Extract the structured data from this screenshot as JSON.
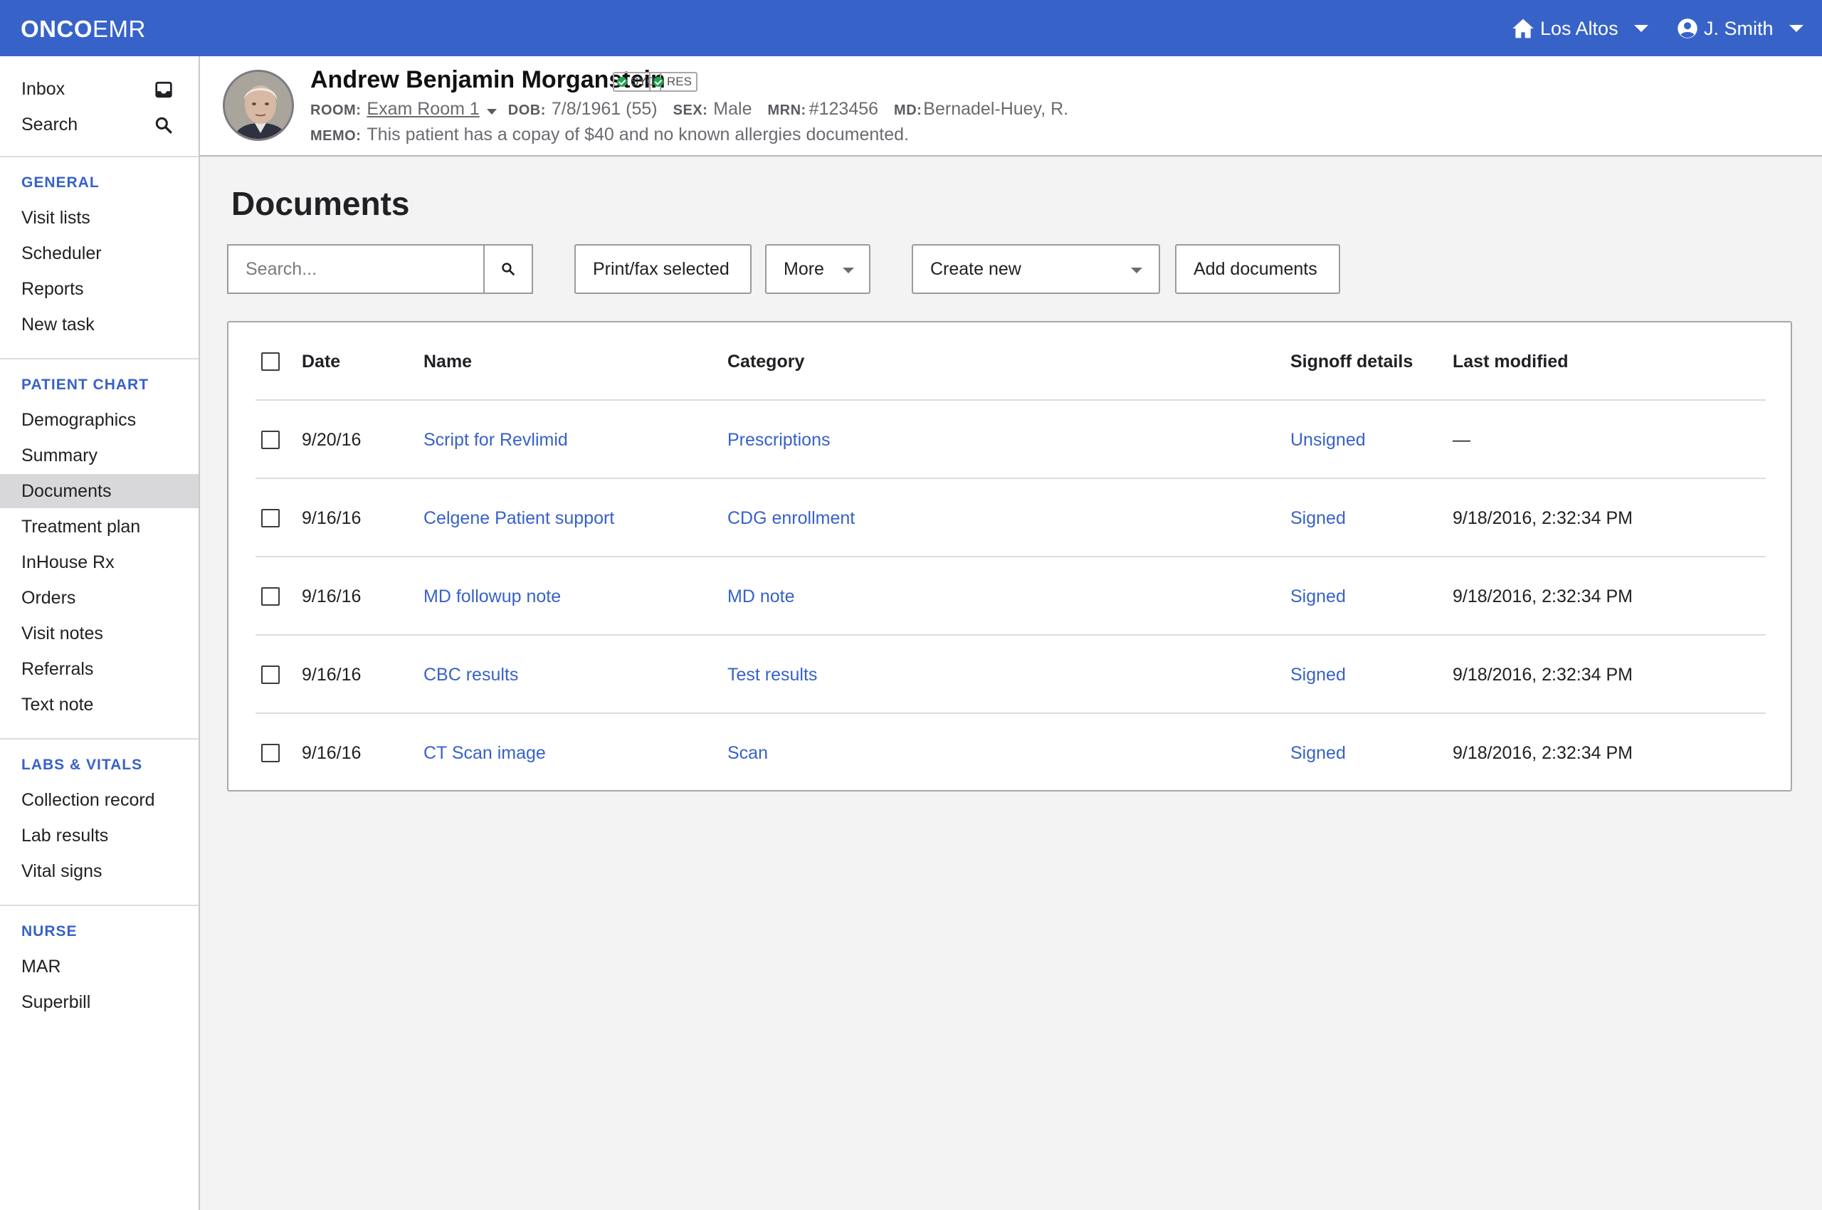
{
  "brand": {
    "bold": "ONCO",
    "light": "EMR"
  },
  "topbar": {
    "location": "Los Altos",
    "user": "J. Smith"
  },
  "sidebar": {
    "top_items": [
      {
        "label": "Inbox",
        "icon": "inbox-icon"
      },
      {
        "label": "Search",
        "icon": "search-icon"
      }
    ],
    "sections": [
      {
        "heading": "GENERAL",
        "items": [
          "Visit lists",
          "Scheduler",
          "Reports",
          "New task"
        ]
      },
      {
        "heading": "PATIENT CHART",
        "items": [
          "Demographics",
          "Summary",
          "Documents",
          "Treatment plan",
          "InHouse Rx",
          "Orders",
          "Visit notes",
          "Referrals",
          "Text note"
        ]
      },
      {
        "heading": "LABS & VITALS",
        "items": [
          "Collection record",
          "Lab results",
          "Vital signs"
        ]
      },
      {
        "heading": "NURSE",
        "items": [
          "MAR",
          "Superbill"
        ]
      }
    ],
    "active": "Documents"
  },
  "patient": {
    "name": "Andrew Benjamin Morganstein",
    "badges": [
      "SYC",
      "RES"
    ],
    "room_label": "ROOM:",
    "room": "Exam Room 1",
    "dob_label": "DOB:",
    "dob": "7/8/1961 (55)",
    "sex_label": "SEX:",
    "sex": "Male",
    "mrn_label": "MRN:",
    "mrn": "#123456",
    "md_label": "MD:",
    "md": "Bernadel-Huey, R.",
    "memo_label": "MEMO:",
    "memo": "This patient has a copay of $40 and no known allergies documented."
  },
  "page": {
    "title": "Documents"
  },
  "toolbar": {
    "search_placeholder": "Search...",
    "print_fax": "Print/fax selected",
    "more": "More",
    "create_new": "Create new",
    "add_documents": "Add documents"
  },
  "table": {
    "headers": {
      "date": "Date",
      "name": "Name",
      "category": "Category",
      "signoff": "Signoff details",
      "modified": "Last modified"
    },
    "rows": [
      {
        "date": "9/20/16",
        "name": "Script for Revlimid",
        "category": "Prescriptions",
        "signoff": "Unsigned",
        "modified": "—"
      },
      {
        "date": "9/16/16",
        "name": "Celgene Patient support",
        "category": "CDG enrollment",
        "signoff": "Signed",
        "modified": "9/18/2016, 2:32:34 PM"
      },
      {
        "date": "9/16/16",
        "name": "MD followup note",
        "category": "MD note",
        "signoff": "Signed",
        "modified": "9/18/2016, 2:32:34 PM"
      },
      {
        "date": "9/16/16",
        "name": "CBC results",
        "category": "Test results",
        "signoff": "Signed",
        "modified": "9/18/2016, 2:32:34 PM"
      },
      {
        "date": "9/16/16",
        "name": "CT Scan image",
        "category": "Scan",
        "signoff": "Signed",
        "modified": "9/18/2016, 2:32:34 PM"
      }
    ]
  },
  "colors": {
    "primary": "#3762c8",
    "active_bg": "#d8d8da",
    "badge_check": "#1fa54b"
  }
}
